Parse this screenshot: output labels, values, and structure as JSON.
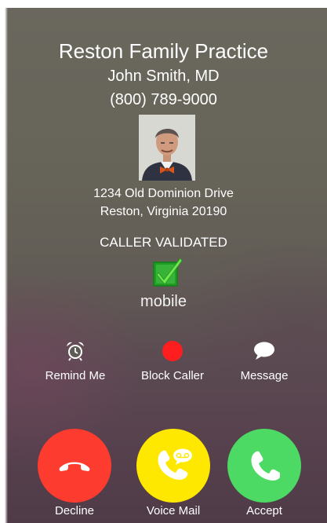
{
  "caller": {
    "practice": "Reston Family Practice",
    "name": "John Smith, MD",
    "phone": "(800) 789-9000",
    "address_line1": "1234 Old Dominion Drive",
    "address_line2": "Reston, Virginia 20190"
  },
  "validation": {
    "status": "CALLER VALIDATED",
    "icon": "green-checkbox-icon",
    "line_type": "mobile"
  },
  "actions": [
    {
      "label": "Remind Me",
      "icon": "alarm-clock-icon"
    },
    {
      "label": "Block Caller",
      "icon": "red-dot-icon"
    },
    {
      "label": "Message",
      "icon": "speech-bubble-icon"
    }
  ],
  "call_buttons": [
    {
      "label": "Decline",
      "icon": "hang-up-phone-icon",
      "color": "#fe3b2f"
    },
    {
      "label": "Voice Mail",
      "icon": "voicemail-phone-icon",
      "color": "#ffe800"
    },
    {
      "label": "Accept",
      "icon": "phone-icon",
      "color": "#4cd964"
    }
  ],
  "colors": {
    "accept": "#4cd964",
    "decline": "#fe3b2f",
    "voicemail": "#ffe800",
    "block": "#fe1e1f",
    "validated_check": "#2fc52a"
  }
}
